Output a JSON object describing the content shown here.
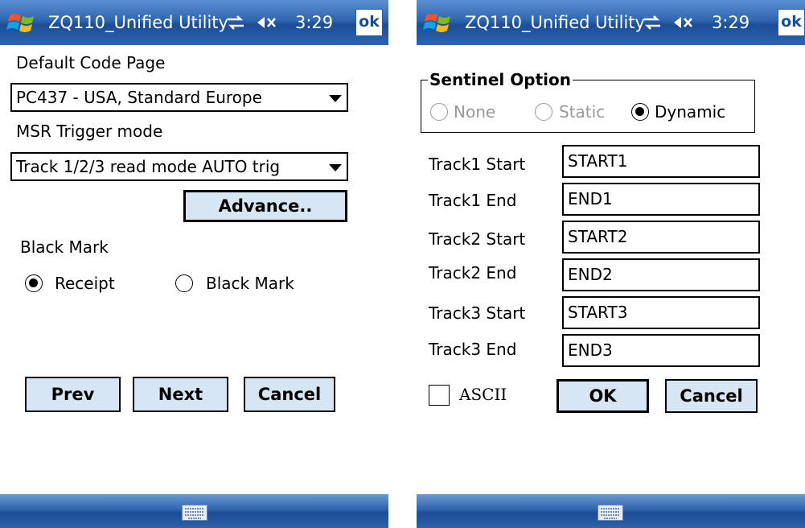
{
  "left_screen": {
    "titlebar": {
      "app_title": "ZQ110_Unified Utility",
      "time": "3:29",
      "ok_label": "ok"
    },
    "code_page_label": "Default Code Page",
    "code_page_value": "PC437 - USA, Standard Europe",
    "msr_label": "MSR Trigger mode",
    "msr_value": "Track 1/2/3 read mode AUTO trig",
    "advance_label": "Advance..",
    "black_mark_label": "Black Mark",
    "radio_receipt": "Receipt",
    "radio_black_mark": "Black Mark",
    "prev_label": "Prev",
    "next_label": "Next",
    "cancel_label": "Cancel"
  },
  "right_screen": {
    "titlebar": {
      "app_title": "ZQ110_Unified Utility",
      "time": "3:29",
      "ok_label": "ok"
    },
    "sentinel_title": "Sentinel Option",
    "opt_none": "None",
    "opt_static": "Static",
    "opt_dynamic": "Dynamic",
    "tracks": [
      {
        "label": "Track1 Start",
        "value": "START1"
      },
      {
        "label": "Track1 End",
        "value": "END1"
      },
      {
        "label": "Track2 Start",
        "value": "START2"
      },
      {
        "label": "Track2 End",
        "value": "END2"
      },
      {
        "label": "Track3 Start",
        "value": "START3"
      },
      {
        "label": "Track3 End",
        "value": "END3"
      }
    ],
    "ascii_label": "ASCII",
    "ok_label": "OK",
    "cancel_label": "Cancel"
  },
  "colors": {
    "titlebar": "#2f66b0",
    "button_fill": "#d6e6f5",
    "disabled_text": "#9a9a9a"
  },
  "icons": [
    "windows-start-icon",
    "sync-icon",
    "volume-muted-icon",
    "keyboard-icon"
  ]
}
